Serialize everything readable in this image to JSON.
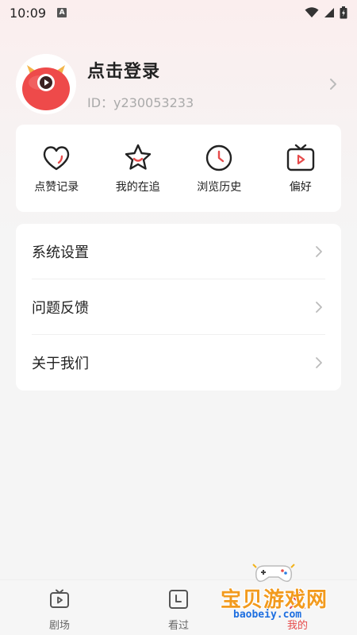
{
  "status_bar": {
    "time": "10:09",
    "a_badge": "A"
  },
  "profile": {
    "title": "点击登录",
    "id_text": "ID：y230053233"
  },
  "quick_actions": [
    {
      "label": "点赞记录",
      "icon": "heart-icon"
    },
    {
      "label": "我的在追",
      "icon": "star-icon"
    },
    {
      "label": "浏览历史",
      "icon": "clock-icon"
    },
    {
      "label": "偏好",
      "icon": "tv-icon"
    }
  ],
  "settings": [
    {
      "label": "系统设置"
    },
    {
      "label": "问题反馈"
    },
    {
      "label": "关于我们"
    }
  ],
  "bottom_nav": [
    {
      "label": "剧场",
      "icon": "theater-icon"
    },
    {
      "label": "看过",
      "icon": "watched-icon"
    },
    {
      "label": "我的",
      "icon": "mine-icon"
    }
  ],
  "watermark": {
    "main": "宝贝游戏网",
    "sub": "baobeiy.com"
  },
  "colors": {
    "accent": "#e64b4b",
    "card": "#ffffff",
    "background": "#f5f5f5"
  }
}
